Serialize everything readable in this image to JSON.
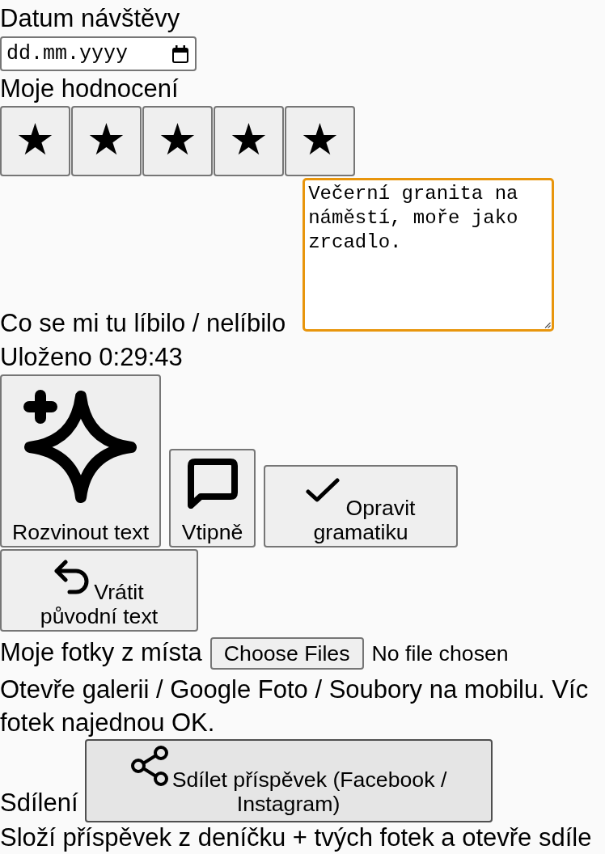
{
  "visit_date": {
    "label": "Datum návštěvy",
    "placeholder": "dd.mm.yyyy"
  },
  "rating": {
    "label": "Moje hodnocení",
    "star_buttons": [
      "★",
      "★",
      "★",
      "★",
      "★"
    ]
  },
  "notes": {
    "label": "Co se mi tu líbilo / nelíbilo",
    "value": "Večerní granita na náměstí, moře jako zrcadlo.",
    "focused": true
  },
  "saved_status": "Uloženo 0:29:43",
  "actions": [
    {
      "kind": "expand",
      "label": "Rozvinout text"
    },
    {
      "kind": "funny",
      "label": "Vtipně"
    },
    {
      "kind": "grammar",
      "label": "Opravit gramatiku"
    },
    {
      "kind": "revert",
      "label": "Vrátit původní text"
    }
  ],
  "photos": {
    "label": "Moje fotky z místa",
    "button": "Choose Files",
    "status": "No file chosen",
    "hint": "Otevře galerii / Google Foto / Soubory na mobilu. Víc fotek najednou OK."
  },
  "sharing": {
    "label": "Sdílení",
    "button": "Sdílet příspěvek (Facebook / Instagram)",
    "hovered": true,
    "hint": "Složí příspěvek z deníčku + tvých fotek a otevře sdíle"
  }
}
